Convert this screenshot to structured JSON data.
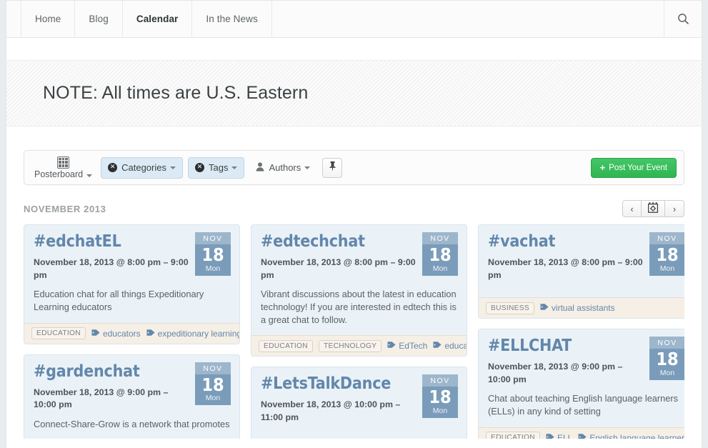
{
  "nav": {
    "items": [
      {
        "label": "Home",
        "active": false
      },
      {
        "label": "Blog",
        "active": false
      },
      {
        "label": "Calendar",
        "active": true
      },
      {
        "label": "In the News",
        "active": false
      }
    ],
    "search_icon": "search-icon"
  },
  "banner": {
    "title": "NOTE: All times are U.S. Eastern"
  },
  "toolbar": {
    "view_label": "Posterboard",
    "view_icon": "grid-icon",
    "categories_label": "Categories",
    "tags_label": "Tags",
    "authors_label": "Authors",
    "authors_icon": "person-icon",
    "pin_icon": "pin-icon",
    "post_label": "Post Your Event",
    "post_plus": "+",
    "clear_icon": "circle-x-icon"
  },
  "calendar": {
    "month_label": "NOVEMBER 2013",
    "prev_label": "‹",
    "next_label": "›",
    "settings_icon": "calendar-gear-icon"
  },
  "colors": {
    "card_bg": "#eaf2f7",
    "card_footer_bg": "#f6efe6",
    "title_blue": "#6287ab",
    "badge_blue": "#7a9cba",
    "badge_month_blue": "#9db6cb",
    "post_button_green": "#2fb551",
    "filter_active_blue": "#dceaf5"
  },
  "columns": [
    {
      "cards": [
        {
          "title": "#edchatEL",
          "date": "November 18, 2013 @ 8:00 pm – 9:00 pm",
          "description": "Education chat for all things Expeditionary Learning educators",
          "badge": {
            "month": "NOV",
            "day": "18",
            "dow": "Mon"
          },
          "categories": [
            "EDUCATION"
          ],
          "tags": [
            "educators",
            "expeditionary learning"
          ]
        },
        {
          "title": "#gardenchat",
          "date": "November 18, 2013 @ 9:00 pm – 10:00 pm",
          "description": "Connect-Share-Grow is a network that promotes",
          "badge": {
            "month": "NOV",
            "day": "18",
            "dow": "Mon"
          },
          "categories": [],
          "tags": []
        }
      ]
    },
    {
      "cards": [
        {
          "title": "#edtechchat",
          "date": "November 18, 2013 @ 8:00 pm – 9:00 pm",
          "description": "Vibrant discussions about the latest in education technology! If you are interested in edtech this is a great chat to follow.",
          "badge": {
            "month": "NOV",
            "day": "18",
            "dow": "Mon"
          },
          "categories": [
            "EDUCATION",
            "TECHNOLOGY"
          ],
          "tags": [
            "EdTech",
            "education te"
          ]
        },
        {
          "title": "#LetsTalkDance",
          "date": "November 18, 2013 @ 10:00 pm – 11:00 pm",
          "description": "",
          "badge": {
            "month": "NOV",
            "day": "18",
            "dow": "Mon"
          },
          "categories": [],
          "tags": []
        }
      ]
    },
    {
      "cards": [
        {
          "title": "#vachat",
          "date": "November 18, 2013 @ 8:00 pm – 9:00 pm",
          "description": "",
          "badge": {
            "month": "NOV",
            "day": "18",
            "dow": "Mon"
          },
          "categories": [
            "BUSINESS"
          ],
          "tags": [
            "virtual assistants"
          ]
        },
        {
          "title": "#ELLCHAT",
          "date": "November 18, 2013 @ 9:00 pm – 10:00 pm",
          "description": "Chat about teaching English language learners (ELLs) in any kind of setting",
          "badge": {
            "month": "NOV",
            "day": "18",
            "dow": "Mon"
          },
          "categories": [
            "EDUCATION"
          ],
          "tags": [
            "ELL",
            "English language learners"
          ]
        }
      ]
    }
  ]
}
